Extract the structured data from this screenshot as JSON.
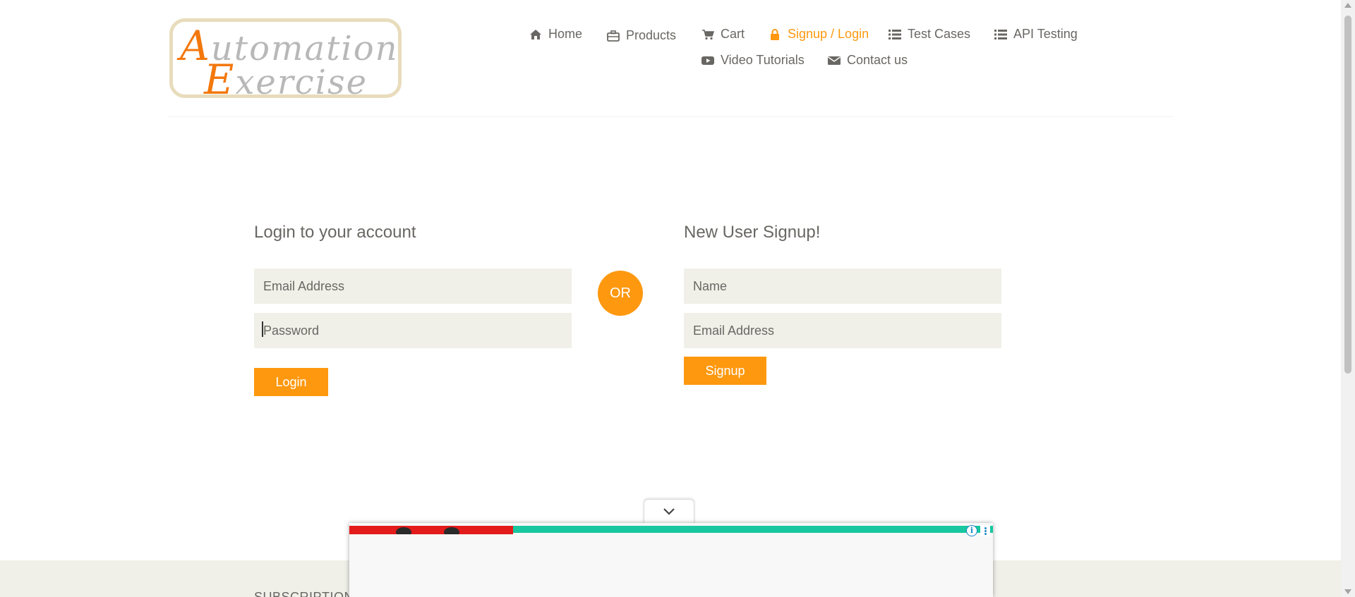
{
  "logo": {
    "line1_cap": "A",
    "line1_rest": "utomation",
    "line2_cap": "E",
    "line2_rest": "xercise"
  },
  "nav": {
    "items": [
      {
        "label": "Home",
        "icon": "home-icon"
      },
      {
        "label": "Products",
        "icon": "briefcase-icon"
      },
      {
        "label": "Cart",
        "icon": "cart-icon"
      },
      {
        "label": "Signup / Login",
        "icon": "lock-icon",
        "active": true
      },
      {
        "label": "Test Cases",
        "icon": "list-icon"
      },
      {
        "label": "API Testing",
        "icon": "list-icon"
      },
      {
        "label": "Video Tutorials",
        "icon": "youtube-icon"
      },
      {
        "label": "Contact us",
        "icon": "envelope-icon"
      }
    ]
  },
  "login": {
    "title": "Login to your account",
    "email_placeholder": "Email Address",
    "password_placeholder": "Password",
    "button": "Login"
  },
  "or_label": "OR",
  "signup": {
    "title": "New User Signup!",
    "name_placeholder": "Name",
    "email_placeholder": "Email Address",
    "button": "Signup"
  },
  "footer": {
    "subscription_title": "SUBSCRIPTION"
  },
  "ad": {
    "info_icon": "info-icon",
    "menu_icon": "kebab-menu-icon",
    "collapse_icon": "chevron-down-icon"
  },
  "colors": {
    "accent": "#fe980f",
    "text": "#696763",
    "input_bg": "#f0f0e9",
    "footer_bg": "#f0f0e9"
  }
}
